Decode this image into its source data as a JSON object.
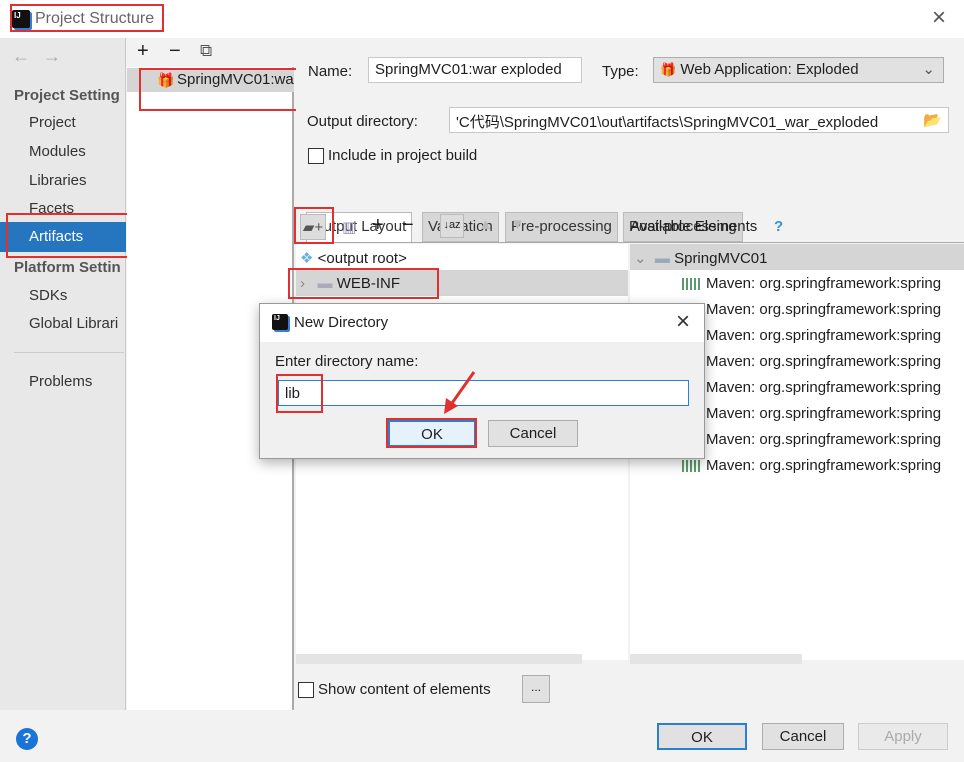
{
  "window": {
    "title": "Project Structure",
    "close": "×"
  },
  "sidebar": {
    "back": "←",
    "forward": "→",
    "project_settings": "Project Setting",
    "items": [
      "Project",
      "Modules",
      "Libraries",
      "Facets",
      "Artifacts"
    ],
    "platform_settings": "Platform Settin",
    "platform_items": [
      "SDKs",
      "Global Librari"
    ],
    "problems": "Problems",
    "selected": "Artifacts"
  },
  "artifacts": {
    "add": "+",
    "remove": "−",
    "copy": "⧉",
    "items": [
      "SpringMVC01:wa"
    ]
  },
  "main": {
    "name_label": "Name:",
    "name_value": "SpringMVC01:war exploded",
    "type_label": "Type:",
    "type_value": "Web Application: Exploded",
    "output_label": "Output directory:",
    "output_value": "'C代码\\SpringMVC01\\out\\artifacts\\SpringMVC01_war_exploded",
    "include_label": "Include in project build",
    "include_checked": false,
    "tabs": [
      "Output Layout",
      "Validation",
      "Pre-processing",
      "Post-processing"
    ],
    "active_tab": "Output Layout",
    "layout_tree": [
      "<output root>",
      "WEB-INF"
    ],
    "available_label": "Available Elements",
    "help": "?",
    "available_root": "SpringMVC01",
    "available_items": [
      "Maven: org.springframework:spring",
      "Maven: org.springframework:spring",
      "Maven: org.springframework:spring",
      "Maven: org.springframework:spring",
      "Maven: org.springframework:spring",
      "Maven: org.springframework:spring",
      "Maven: org.springframework:spring",
      "Maven: org.springframework:spring"
    ],
    "show_content_label": "Show content of elements",
    "more": "..."
  },
  "footer": {
    "help": "?",
    "ok": "OK",
    "cancel": "Cancel",
    "apply": "Apply"
  },
  "dialog": {
    "title": "New Directory",
    "close": "×",
    "prompt": "Enter directory name:",
    "value": "lib",
    "ok": "OK",
    "cancel": "Cancel"
  },
  "colors": {
    "selection": "#2675bf",
    "highlight": "#e03030"
  }
}
